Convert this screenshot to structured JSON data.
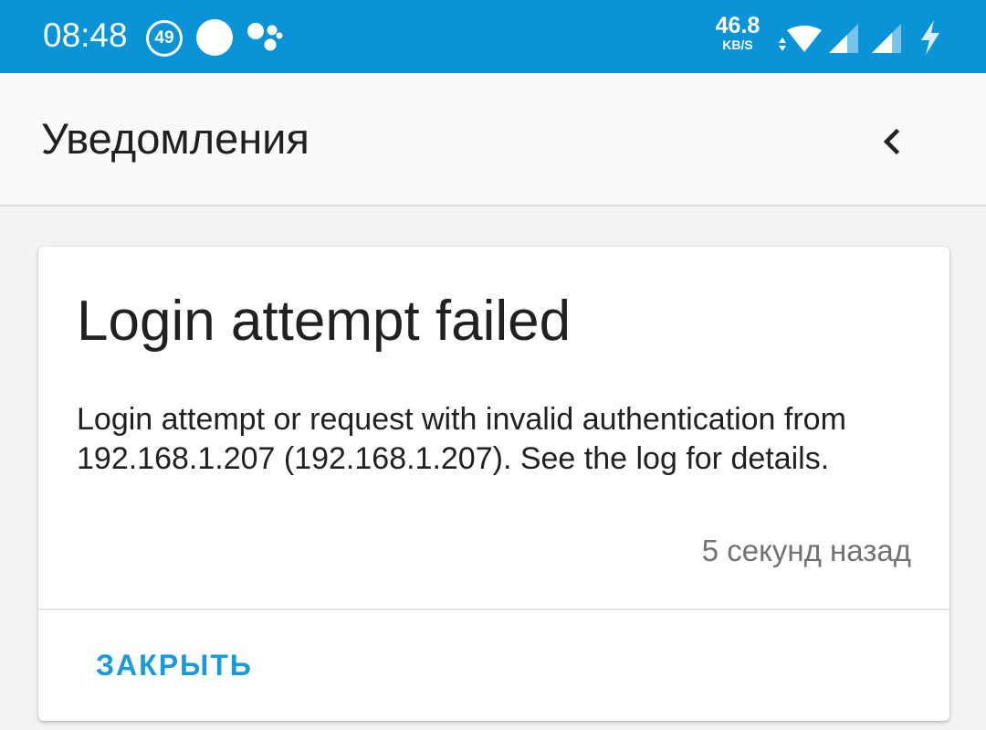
{
  "status_bar": {
    "time": "08:48",
    "notification_badge": "49",
    "network_speed": "46.8",
    "network_speed_unit": "KB/S",
    "icons": [
      "notification-count-icon",
      "circle-dot-icon",
      "assistant-icon",
      "data-transfer-icon",
      "wifi-icon",
      "signal-icon",
      "signal-icon",
      "charging-icon"
    ],
    "color": "#0a93d6"
  },
  "app_bar": {
    "title": "Уведомления",
    "back_icon": "chevron-left-icon"
  },
  "notification": {
    "title": "Login attempt failed",
    "message": "Login attempt or request with invalid authentication from 192.168.1.207 (192.168.1.207). See the log for details.",
    "timestamp": "5 секунд назад",
    "close_label": "ЗАКРЫТЬ",
    "accent_color": "#1a9ad8"
  }
}
